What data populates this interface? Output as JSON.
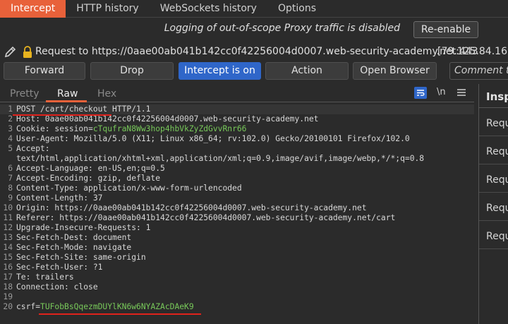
{
  "tabs": [
    "Intercept",
    "HTTP history",
    "WebSockets history",
    "Options"
  ],
  "logging": {
    "message": "Logging of out-of-scope Proxy traffic is disabled",
    "reenable_label": "Re-enable"
  },
  "request": {
    "label": "Request to https://0aae00ab041b142cc0f42256004d0007.web-security-academy.net:443",
    "ip": "[79.125.84.16]"
  },
  "toolbar": {
    "forward": "Forward",
    "drop": "Drop",
    "intercept": "Intercept is on",
    "action": "Action",
    "open_browser": "Open Browser",
    "comment_placeholder": "Comment th"
  },
  "subtabs": {
    "pretty": "Pretty",
    "raw": "Raw",
    "hex": "Hex",
    "newline": "\\n"
  },
  "code_lines": [
    {
      "n": "1",
      "parts": [
        {
          "t": "POST /cart/checkout HTTP/1.1"
        }
      ]
    },
    {
      "n": "2",
      "parts": [
        {
          "t": "Host: 0aae00ab041b142cc0f42256004d0007.web-security-academy.net"
        }
      ]
    },
    {
      "n": "3",
      "parts": [
        {
          "t": "Cookie: session="
        },
        {
          "t": "cTqufraN8Ww3hop4hbVkZyZdGvvRnr66",
          "c": "green"
        }
      ]
    },
    {
      "n": "4",
      "parts": [
        {
          "t": "User-Agent: Mozilla/5.0 (X11; Linux x86_64; rv:102.0) Gecko/20100101 Firefox/102.0"
        }
      ]
    },
    {
      "n": "5",
      "parts": [
        {
          "t": "Accept:"
        }
      ]
    },
    {
      "n": "",
      "parts": [
        {
          "t": "text/html,application/xhtml+xml,application/xml;q=0.9,image/avif,image/webp,*/*;q=0.8"
        }
      ]
    },
    {
      "n": "6",
      "parts": [
        {
          "t": "Accept-Language: en-US,en;q=0.5"
        }
      ]
    },
    {
      "n": "7",
      "parts": [
        {
          "t": "Accept-Encoding: gzip, deflate"
        }
      ]
    },
    {
      "n": "8",
      "parts": [
        {
          "t": "Content-Type: application/x-www-form-urlencoded"
        }
      ]
    },
    {
      "n": "9",
      "parts": [
        {
          "t": "Content-Length: 37"
        }
      ]
    },
    {
      "n": "10",
      "parts": [
        {
          "t": "Origin: https://0aae00ab041b142cc0f42256004d0007.web-security-academy.net"
        }
      ]
    },
    {
      "n": "11",
      "parts": [
        {
          "t": "Referer: https://0aae00ab041b142cc0f42256004d0007.web-security-academy.net/cart"
        }
      ]
    },
    {
      "n": "12",
      "parts": [
        {
          "t": "Upgrade-Insecure-Requests: 1"
        }
      ]
    },
    {
      "n": "13",
      "parts": [
        {
          "t": "Sec-Fetch-Dest: document"
        }
      ]
    },
    {
      "n": "14",
      "parts": [
        {
          "t": "Sec-Fetch-Mode: navigate"
        }
      ]
    },
    {
      "n": "15",
      "parts": [
        {
          "t": "Sec-Fetch-Site: same-origin"
        }
      ]
    },
    {
      "n": "16",
      "parts": [
        {
          "t": "Sec-Fetch-User: ?1"
        }
      ]
    },
    {
      "n": "17",
      "parts": [
        {
          "t": "Te: trailers"
        }
      ]
    },
    {
      "n": "18",
      "parts": [
        {
          "t": "Connection: close"
        }
      ]
    },
    {
      "n": "19",
      "parts": [
        {
          "t": ""
        }
      ]
    },
    {
      "n": "20",
      "parts": [
        {
          "t": "csrf="
        },
        {
          "t": "TUFobBsQqezmDUYlKN6w6NYAZAcDAeK9",
          "c": "green"
        }
      ]
    }
  ],
  "inspector": {
    "title": "Insp",
    "items": [
      "Requ",
      "Requ",
      "Requ",
      "Requ",
      "Requ"
    ]
  },
  "colors": {
    "accent": "#e8613a",
    "intercept_on": "#2f66c9",
    "highlight": "#78c95a",
    "annotation": "#e0221c"
  }
}
